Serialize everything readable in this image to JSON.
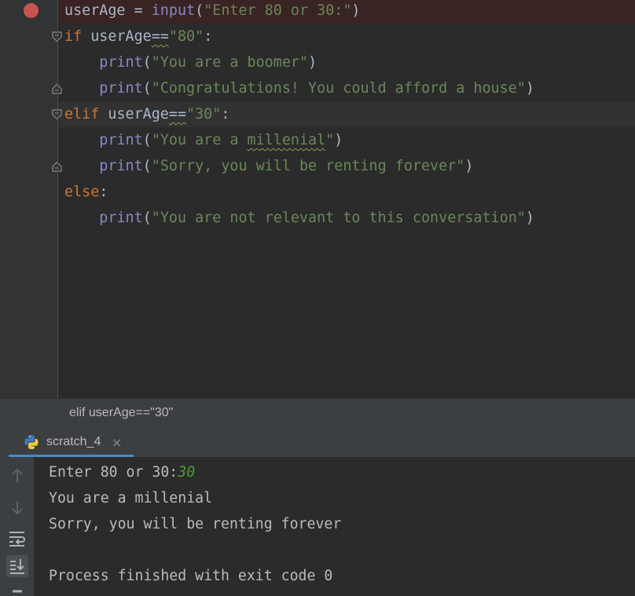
{
  "editor": {
    "lines": [
      {
        "parts": [
          {
            "t": "userAge = ",
            "c": "op"
          },
          {
            "t": "input",
            "c": "fn"
          },
          {
            "t": "(",
            "c": "op"
          },
          {
            "t": "\"Enter 80 or 30:\"",
            "c": "str"
          },
          {
            "t": ")",
            "c": "op"
          }
        ]
      },
      {
        "parts": [
          {
            "t": "if",
            "c": "kw"
          },
          {
            "t": " userAge",
            "c": "op"
          },
          {
            "t": "==",
            "c": "op squig"
          },
          {
            "t": "\"80\"",
            "c": "str"
          },
          {
            "t": ":",
            "c": "op"
          }
        ]
      },
      {
        "parts": [
          {
            "t": "    ",
            "c": "op"
          },
          {
            "t": "print",
            "c": "fn"
          },
          {
            "t": "(",
            "c": "op"
          },
          {
            "t": "\"You are a boomer\"",
            "c": "str"
          },
          {
            "t": ")",
            "c": "op"
          }
        ]
      },
      {
        "parts": [
          {
            "t": "    ",
            "c": "op"
          },
          {
            "t": "print",
            "c": "fn"
          },
          {
            "t": "(",
            "c": "op"
          },
          {
            "t": "\"Congratulations! You could afford a house\"",
            "c": "str"
          },
          {
            "t": ")",
            "c": "op"
          }
        ]
      },
      {
        "parts": [
          {
            "t": "elif",
            "c": "kw"
          },
          {
            "t": " userAge",
            "c": "op"
          },
          {
            "t": "==",
            "c": "op squig"
          },
          {
            "t": "\"30\"",
            "c": "str"
          },
          {
            "t": ":",
            "c": "op"
          }
        ]
      },
      {
        "parts": [
          {
            "t": "    ",
            "c": "op"
          },
          {
            "t": "print",
            "c": "fn"
          },
          {
            "t": "(",
            "c": "op"
          },
          {
            "t": "\"You are a ",
            "c": "str"
          },
          {
            "t": "millenial",
            "c": "str squig"
          },
          {
            "t": "\"",
            "c": "str"
          },
          {
            "t": ")",
            "c": "op"
          }
        ]
      },
      {
        "parts": [
          {
            "t": "    ",
            "c": "op"
          },
          {
            "t": "print",
            "c": "fn"
          },
          {
            "t": "(",
            "c": "op"
          },
          {
            "t": "\"Sorry, you will be renting forever\"",
            "c": "str"
          },
          {
            "t": ")",
            "c": "op"
          }
        ]
      },
      {
        "parts": [
          {
            "t": "else",
            "c": "kw"
          },
          {
            "t": ":",
            "c": "op"
          }
        ]
      },
      {
        "parts": [
          {
            "t": "    ",
            "c": "op"
          },
          {
            "t": "print",
            "c": "fn"
          },
          {
            "t": "(",
            "c": "op"
          },
          {
            "t": "\"You are not relevant to this conversation\"",
            "c": "str"
          },
          {
            "t": ")",
            "c": "op"
          }
        ]
      }
    ]
  },
  "breadcrumb": {
    "text": "elif userAge==\"30\""
  },
  "run_panel": {
    "tab_label": "scratch_4",
    "tab_close": "×",
    "tab_icon": "python-icon",
    "toolbar_icons": [
      "arrow-up-icon",
      "arrow-down-icon",
      "soft-wrap-icon",
      "scroll-to-end-icon",
      "collapse-icon"
    ],
    "console": {
      "prompt": "Enter 80 or 30:",
      "user_input": "30",
      "line2": "You are a millenial",
      "line3": "Sorry, you will be renting forever",
      "line4": "",
      "line5": "Process finished with exit code 0"
    }
  },
  "colors": {
    "keyword": "#cc7832",
    "builtin": "#8888c6",
    "string": "#6a8759",
    "identifier": "#a9b7c6",
    "breakpoint": "#c75450",
    "console_input": "#4e9a2f",
    "tab_underline": "#4a88c7"
  }
}
